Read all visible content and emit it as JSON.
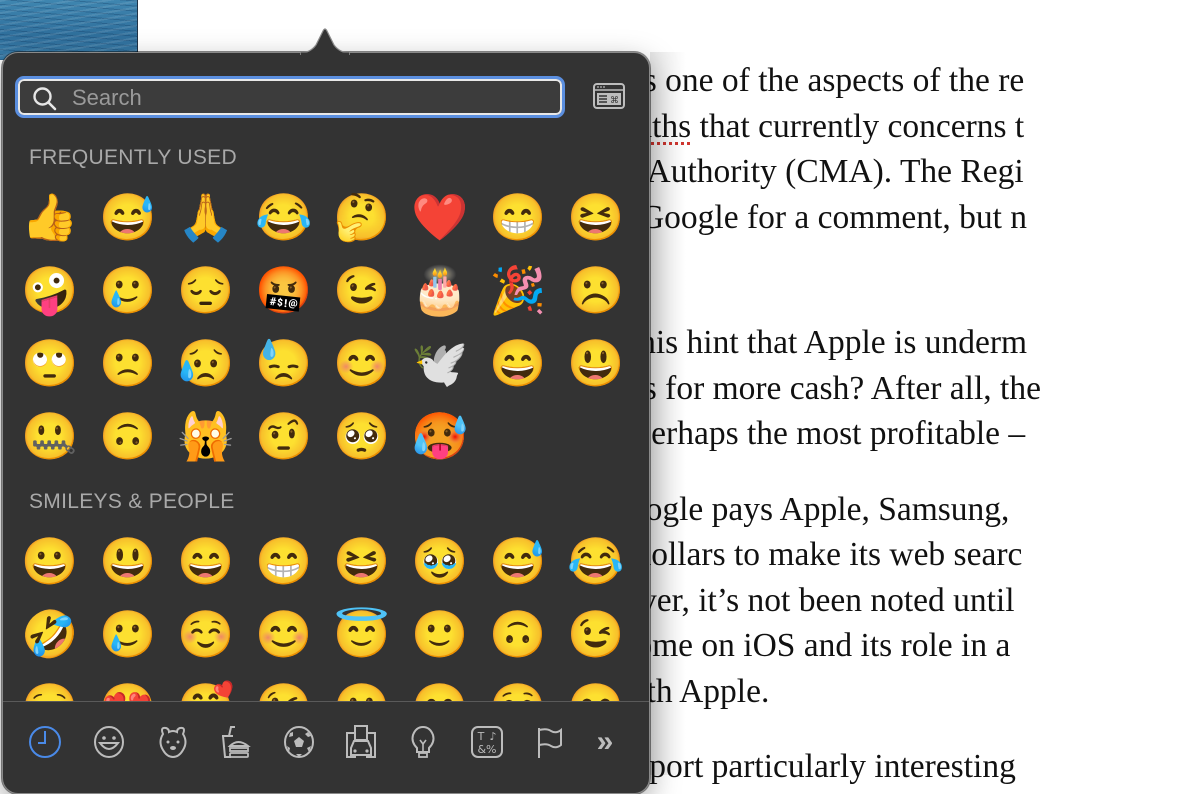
{
  "document": {
    "lines_block1": [
      {
        "text": "t this is one of the aspects of the re"
      },
      {
        "pre": "h ",
        "spell": "goliaths",
        "post": " that currently concerns t"
      },
      {
        "text": "arkets Authority (CMA). The Regi"
      },
      {
        "text": "e and Google for a comment, but n"
      }
    ],
    "lines_block2": [
      "does this hint that Apple is underm",
      "Phones for more cash? After all, the",
      "le — perhaps the most profitable –"
    ],
    "lines_block3": [
      "es, Google pays Apple, Samsung, ",
      "ns of dollars to make its web searc",
      "However, it’s not been noted until ",
      "o Chrome on iOS and its role in a",
      " has with Apple."
    ],
    "lines_block4": [
      "mor/report particularly interesting"
    ]
  },
  "emoji_picker": {
    "search": {
      "placeholder": "Search",
      "value": ""
    },
    "keyboard_viewer_icon": "keyboard-viewer-icon",
    "accent_color": "#5b8fe0",
    "sections": [
      {
        "title": "FREQUENTLY USED",
        "emojis": [
          {
            "char": "👍",
            "name": "thumbs-up"
          },
          {
            "char": "😅",
            "name": "grinning-face-with-sweat"
          },
          {
            "char": "🙏",
            "name": "folded-hands"
          },
          {
            "char": "😂",
            "name": "face-with-tears-of-joy"
          },
          {
            "char": "🤔",
            "name": "thinking-face"
          },
          {
            "char": "❤️",
            "name": "red-heart"
          },
          {
            "char": "😁",
            "name": "beaming-face"
          },
          {
            "char": "😆",
            "name": "grinning-squinting-face"
          },
          {
            "char": "🤪",
            "name": "zany-face"
          },
          {
            "char": "🥲",
            "name": "smiling-face-with-tear"
          },
          {
            "char": "😔",
            "name": "pensive-face"
          },
          {
            "char": "🤬",
            "name": "face-with-symbols-on-mouth"
          },
          {
            "char": "😉",
            "name": "winking-face"
          },
          {
            "char": "🎂",
            "name": "birthday-cake"
          },
          {
            "char": "🎉",
            "name": "party-popper"
          },
          {
            "char": "☹️",
            "name": "frowning-face"
          },
          {
            "char": "🙄",
            "name": "face-with-rolling-eyes"
          },
          {
            "char": "🙁",
            "name": "slightly-frowning-face"
          },
          {
            "char": "😥",
            "name": "sad-but-relieved-face"
          },
          {
            "char": "😓",
            "name": "downcast-face-with-sweat"
          },
          {
            "char": "😊",
            "name": "smiling-face-with-smiling-eyes"
          },
          {
            "char": "🕊️",
            "name": "dove"
          },
          {
            "char": "😄",
            "name": "grinning-face-with-smiling-eyes"
          },
          {
            "char": "😃",
            "name": "grinning-face-with-big-eyes"
          },
          {
            "char": "🤐",
            "name": "zipper-mouth-face"
          },
          {
            "char": "🙃",
            "name": "upside-down-face"
          },
          {
            "char": "🙀",
            "name": "weary-cat"
          },
          {
            "char": "🤨",
            "name": "face-with-raised-eyebrow"
          },
          {
            "char": "🥺",
            "name": "pleading-face"
          },
          {
            "char": "🥵",
            "name": "hot-face"
          }
        ]
      },
      {
        "title": "SMILEYS & PEOPLE",
        "emojis": [
          {
            "char": "😀",
            "name": "grinning-face"
          },
          {
            "char": "😃",
            "name": "grinning-face-with-big-eyes"
          },
          {
            "char": "😄",
            "name": "grinning-face-with-smiling-eyes"
          },
          {
            "char": "😁",
            "name": "beaming-face"
          },
          {
            "char": "😆",
            "name": "grinning-squinting-face"
          },
          {
            "char": "🥹",
            "name": "face-holding-back-tears"
          },
          {
            "char": "😅",
            "name": "grinning-face-with-sweat"
          },
          {
            "char": "😂",
            "name": "face-with-tears-of-joy"
          },
          {
            "char": "🤣",
            "name": "rolling-on-the-floor-laughing"
          },
          {
            "char": "🥲",
            "name": "smiling-face-with-tear"
          },
          {
            "char": "☺️",
            "name": "smiling-face"
          },
          {
            "char": "😊",
            "name": "smiling-face-with-smiling-eyes"
          },
          {
            "char": "😇",
            "name": "smiling-face-with-halo"
          },
          {
            "char": "🙂",
            "name": "slightly-smiling-face"
          },
          {
            "char": "🙃",
            "name": "upside-down-face"
          },
          {
            "char": "😉",
            "name": "winking-face"
          },
          {
            "char": "😌",
            "name": "relieved-face"
          },
          {
            "char": "😍",
            "name": "smiling-face-with-heart-eyes"
          },
          {
            "char": "🥰",
            "name": "smiling-face-with-hearts"
          },
          {
            "char": "😘",
            "name": "face-blowing-a-kiss"
          },
          {
            "char": "😗",
            "name": "kissing-face"
          },
          {
            "char": "😙",
            "name": "kissing-face-with-smiling-eyes"
          },
          {
            "char": "😚",
            "name": "kissing-face-with-closed-eyes"
          },
          {
            "char": "😋",
            "name": "face-savoring-food"
          }
        ]
      }
    ],
    "category_tabs": [
      {
        "name": "recent",
        "icon": "clock-icon",
        "active": true
      },
      {
        "name": "smileys-people",
        "icon": "smiley-icon",
        "active": false
      },
      {
        "name": "animals-nature",
        "icon": "bear-icon",
        "active": false
      },
      {
        "name": "food-drink",
        "icon": "burger-icon",
        "active": false
      },
      {
        "name": "activity",
        "icon": "soccer-ball-icon",
        "active": false
      },
      {
        "name": "travel-places",
        "icon": "car-building-icon",
        "active": false
      },
      {
        "name": "objects",
        "icon": "lightbulb-icon",
        "active": false
      },
      {
        "name": "symbols",
        "icon": "symbols-icon",
        "active": false
      },
      {
        "name": "flags",
        "icon": "flag-icon",
        "active": false
      },
      {
        "name": "more",
        "icon": "double-chevron-right-icon",
        "label": "»",
        "active": false
      }
    ],
    "tab_colors": {
      "active": "#4a8ae8",
      "inactive": "#bcbcbc"
    }
  }
}
